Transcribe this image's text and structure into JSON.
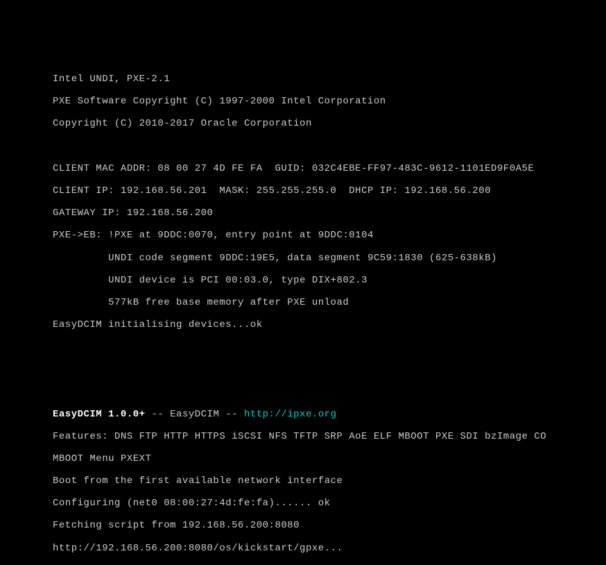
{
  "block1": {
    "l1": "Intel UNDI, PXE-2.1",
    "l2": "PXE Software Copyright (C) 1997-2000 Intel Corporation",
    "l3": "Copyright (C) 2010-2017 Oracle Corporation"
  },
  "block2": {
    "l1": "CLIENT MAC ADDR: 08 00 27 4D FE FA  GUID: 032C4EBE-FF97-483C-9612-1101ED9F0A5E",
    "l2": "CLIENT IP: 192.168.56.201  MASK: 255.255.255.0  DHCP IP: 192.168.56.200",
    "l3": "GATEWAY IP: 192.168.56.200",
    "l4": "PXE->EB: !PXE at 9DDC:0070, entry point at 9DDC:0104",
    "l5": "         UNDI code segment 9DDC:19E5, data segment 9C59:1830 (625-638kB)",
    "l6": "         UNDI device is PCI 00:03.0, type DIX+802.3",
    "l7": "         577kB free base memory after PXE unload",
    "l8": "EasyDCIM initialising devices...ok"
  },
  "block3": {
    "banner_bold": "EasyDCIM 1.0.0+",
    "banner_mid": " -- EasyDCIM -- ",
    "banner_link": "http://ipxe.org",
    "l2": "Features: DNS FTP HTTP HTTPS iSCSI NFS TFTP SRP AoE ELF MBOOT PXE SDI bzImage CO",
    "l3": "MBOOT Menu PXEXT",
    "l4": "Boot from the first available network interface",
    "l5": "Configuring (net0 08:00:27:4d:fe:fa)...... ok",
    "l6": "Fetching script from 192.168.56.200:8080",
    "l7": "http://192.168.56.200:8080/os/kickstart/gpxe..."
  }
}
